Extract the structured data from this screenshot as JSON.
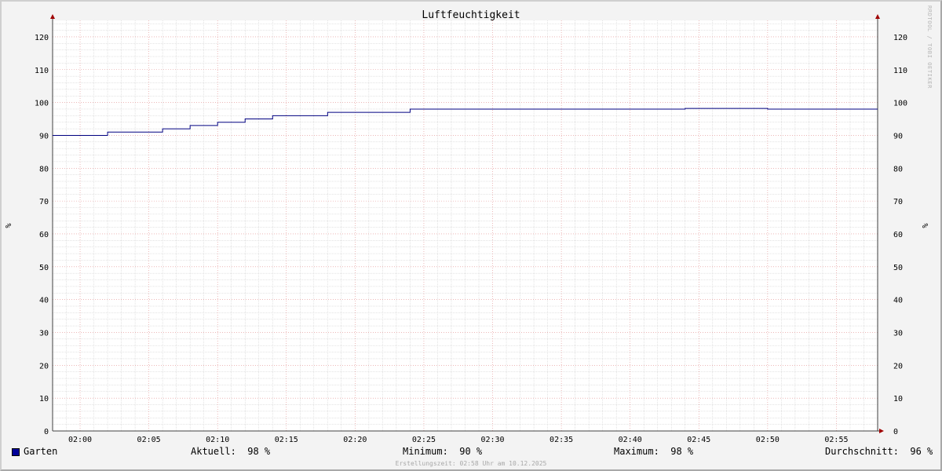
{
  "chart_data": {
    "type": "line",
    "title": "Luftfeuchtigkeit",
    "ylabel": "%",
    "ylabel_right": "%",
    "ylim": [
      0,
      125
    ],
    "yticks": [
      0,
      10,
      20,
      30,
      40,
      50,
      60,
      70,
      80,
      90,
      100,
      110,
      120
    ],
    "xlim": [
      "01:58",
      "02:58"
    ],
    "xticks": [
      "02:00",
      "02:05",
      "02:10",
      "02:15",
      "02:20",
      "02:25",
      "02:30",
      "02:35",
      "02:40",
      "02:45",
      "02:50",
      "02:55"
    ],
    "grid": true,
    "series": [
      {
        "name": "Garten",
        "color": "#000080",
        "x": [
          "01:58",
          "02:02",
          "02:06",
          "02:08",
          "02:10",
          "02:12",
          "02:14",
          "02:18",
          "02:24",
          "02:44",
          "02:50",
          "02:58"
        ],
        "y": [
          90,
          91,
          92,
          93,
          94,
          95,
          96,
          97,
          98,
          98.2,
          98,
          98
        ]
      }
    ]
  },
  "watermark": "RRDTOOL / TOBI OETIKER",
  "legend": {
    "series_label": "Garten",
    "series_color": "#000099",
    "current": "Aktuell:  98 %",
    "minimum": "Minimum:  90 %",
    "maximum": "Maximum:  98 %",
    "average": "Durchschnitt:  96 %"
  },
  "footer": "Erstellungszeit: 02:58 Uhr am 10.12.2025",
  "colors": {
    "plot_background": "#ffffff",
    "minor_grid": "#c8c8c8",
    "major_grid": "#e28c8c",
    "axis": "#404040",
    "arrow": "#a00000"
  }
}
